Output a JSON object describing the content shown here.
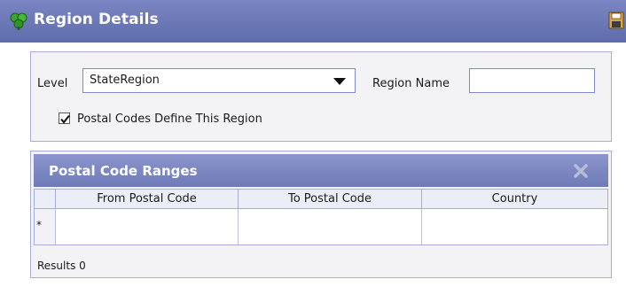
{
  "window": {
    "title": "Region Details",
    "accent": "#6f7bb8"
  },
  "form": {
    "level_label": "Level",
    "level_value": "StateRegion",
    "region_name_label": "Region Name",
    "region_name_value": "",
    "postal_codes_checkbox_label": "Postal Codes Define This Region",
    "postal_codes_checked": true
  },
  "ranges": {
    "title": "Postal Code Ranges",
    "columns": [
      "From Postal Code",
      "To Postal Code",
      "Country"
    ],
    "new_row_marker": "*",
    "results_text": "Results 0"
  },
  "icons": {
    "app": "clover-group-icon",
    "save": "floppy-disk-icon",
    "delete": "delete-x-icon"
  }
}
